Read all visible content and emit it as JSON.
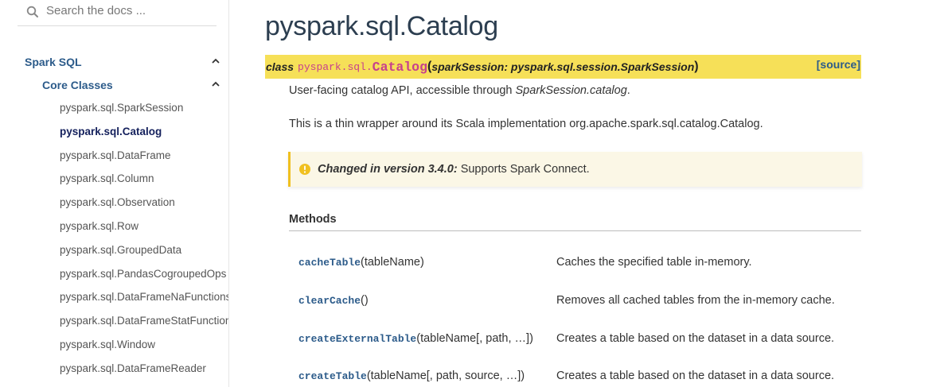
{
  "sidebar": {
    "search_placeholder": "Search the docs ...",
    "section": "Spark SQL",
    "subsection": "Core Classes",
    "items": [
      {
        "label": "pyspark.sql.SparkSession"
      },
      {
        "label": "pyspark.sql.Catalog",
        "active": true
      },
      {
        "label": "pyspark.sql.DataFrame"
      },
      {
        "label": "pyspark.sql.Column"
      },
      {
        "label": "pyspark.sql.Observation"
      },
      {
        "label": "pyspark.sql.Row"
      },
      {
        "label": "pyspark.sql.GroupedData"
      },
      {
        "label": "pyspark.sql.PandasCogroupedOps"
      },
      {
        "label": "pyspark.sql.DataFrameNaFunctions"
      },
      {
        "label": "pyspark.sql.DataFrameStatFunctions"
      },
      {
        "label": "pyspark.sql.Window"
      },
      {
        "label": "pyspark.sql.DataFrameReader"
      }
    ]
  },
  "main": {
    "title": "pyspark.sql.Catalog",
    "signature": {
      "keyword": "class",
      "module": "pyspark.sql.",
      "class_name": "Catalog",
      "open_paren": "(",
      "params": "sparkSession: pyspark.sql.session.SparkSession",
      "close_paren": ")",
      "source_link": "[source]"
    },
    "desc1_prefix": "User-facing catalog API, accessible through ",
    "desc1_em": "SparkSession.catalog",
    "desc1_suffix": ".",
    "desc2": "This is a thin wrapper around its Scala implementation org.apache.spark.sql.catalog.Catalog.",
    "changed": {
      "label": "Changed in version 3.4.0:",
      "text": " Supports Spark Connect."
    },
    "methods_heading": "Methods",
    "methods": [
      {
        "name": "cacheTable",
        "args": "(tableName)",
        "desc": "Caches the specified table in-memory."
      },
      {
        "name": "clearCache",
        "args": "()",
        "desc": "Removes all cached tables from the in-memory cache."
      },
      {
        "name": "createExternalTable",
        "args": "(tableName[, path, …])",
        "desc": "Creates a table based on the dataset in a data source."
      },
      {
        "name": "createTable",
        "args": "(tableName[, path, source, …])",
        "desc": "Creates a table based on the dataset in a data source."
      }
    ]
  },
  "colors": {
    "link": "#2c5b8a",
    "signature_bg": "#f6e058",
    "class_name": "#c7408d",
    "admonition_bg": "#fbf7e6",
    "admonition_border": "#f0c020"
  }
}
